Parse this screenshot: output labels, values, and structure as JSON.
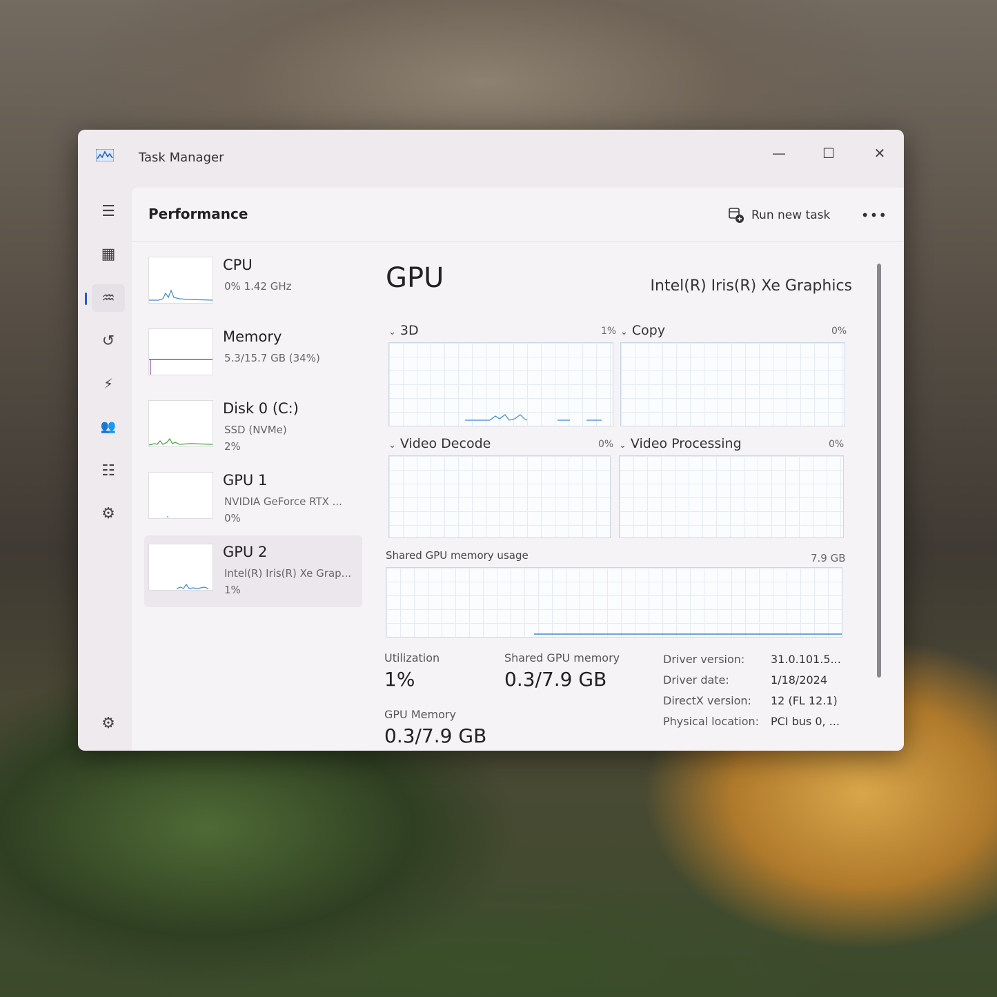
{
  "window": {
    "title": "Task Manager",
    "icon": "task-manager-chart-icon"
  },
  "controls": {
    "minimize": "—",
    "maximize": "☐",
    "close": "✕"
  },
  "rail": {
    "items": [
      {
        "name": "hamburger-menu-icon",
        "glyph": "☰"
      },
      {
        "name": "processes-icon",
        "glyph": "▦"
      },
      {
        "name": "performance-icon",
        "glyph": "♒"
      },
      {
        "name": "app-history-icon",
        "glyph": "↺"
      },
      {
        "name": "startup-apps-icon",
        "glyph": "⚡"
      },
      {
        "name": "users-icon",
        "glyph": "👥"
      },
      {
        "name": "details-icon",
        "glyph": "☷"
      },
      {
        "name": "services-icon",
        "glyph": "⚙"
      }
    ],
    "settings": {
      "name": "settings-gear-icon",
      "glyph": "⚙"
    }
  },
  "header": {
    "title": "Performance",
    "run_new_task": "Run new task",
    "more": "•••"
  },
  "list": [
    {
      "title": "CPU",
      "sub": "0%  1.42 GHz",
      "sub2": ""
    },
    {
      "title": "Memory",
      "sub": "5.3/15.7 GB (34%)",
      "sub2": ""
    },
    {
      "title": "Disk 0 (C:)",
      "sub": "SSD (NVMe)",
      "sub2": "2%"
    },
    {
      "title": "GPU 1",
      "sub": "NVIDIA GeForce RTX ...",
      "sub2": "0%"
    },
    {
      "title": "GPU 2",
      "sub": "Intel(R) Iris(R) Xe Grap...",
      "sub2": "1%"
    }
  ],
  "detail": {
    "title": "GPU",
    "name": "Intel(R) Iris(R) Xe Graphics",
    "engines": [
      {
        "label": "3D",
        "pct": "1%"
      },
      {
        "label": "Copy",
        "pct": "0%"
      },
      {
        "label": "Video Decode",
        "pct": "0%"
      },
      {
        "label": "Video Processing",
        "pct": "0%"
      }
    ],
    "shared_label": "Shared GPU memory usage",
    "shared_max": "7.9 GB",
    "utilization_label": "Utilization",
    "utilization_value": "1%",
    "shared_mem_label": "Shared GPU memory",
    "shared_mem_value": "0.3/7.9 GB",
    "gpu_mem_label": "GPU Memory",
    "gpu_mem_value": "0.3/7.9 GB",
    "props": [
      {
        "k": "Driver version:",
        "v": "31.0.101.5..."
      },
      {
        "k": "Driver date:",
        "v": "1/18/2024"
      },
      {
        "k": "DirectX version:",
        "v": "12 (FL 12.1)"
      },
      {
        "k": "Physical location:",
        "v": "PCI bus 0, ..."
      }
    ]
  }
}
